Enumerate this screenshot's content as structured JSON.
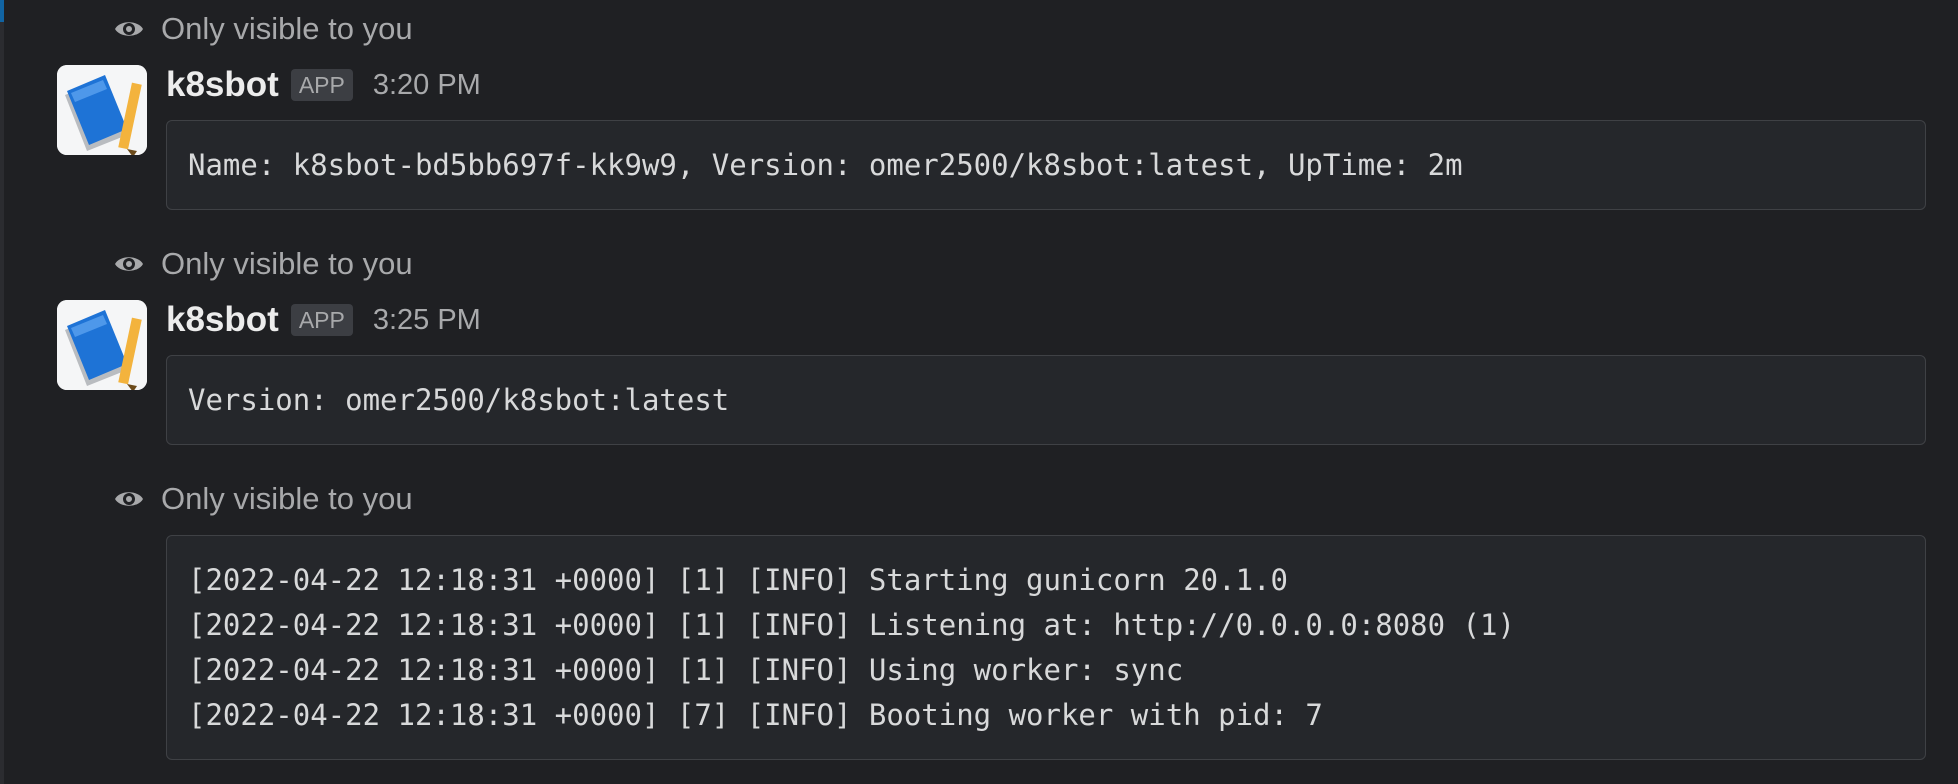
{
  "ephemeral_notice": "Only visible to you",
  "messages": [
    {
      "bot_name": "k8sbot",
      "badge": "APP",
      "time": "3:20 PM",
      "lines": [
        "Name: k8sbot-bd5bb697f-kk9w9, Version: omer2500/k8sbot:latest, UpTime: 2m"
      ]
    },
    {
      "bot_name": "k8sbot",
      "badge": "APP",
      "time": "3:25 PM",
      "lines": [
        "Version: omer2500/k8sbot:latest"
      ]
    },
    {
      "lines": [
        "[2022-04-22 12:18:31 +0000] [1] [INFO] Starting gunicorn 20.1.0",
        "[2022-04-22 12:18:31 +0000] [1] [INFO] Listening at: http://0.0.0.0:8080 (1)",
        "[2022-04-22 12:18:31 +0000] [1] [INFO] Using worker: sync",
        "[2022-04-22 12:18:31 +0000] [7] [INFO] Booting worker with pid: 7"
      ]
    }
  ],
  "icons": {
    "ephemeral": "eye-icon",
    "avatar": "notebook-pencil-avatar"
  },
  "colors": {
    "background": "#1f2023",
    "code_background": "#25272b",
    "avatar_blue": "#1e73d6",
    "avatar_pencil": "#f3b33d"
  }
}
